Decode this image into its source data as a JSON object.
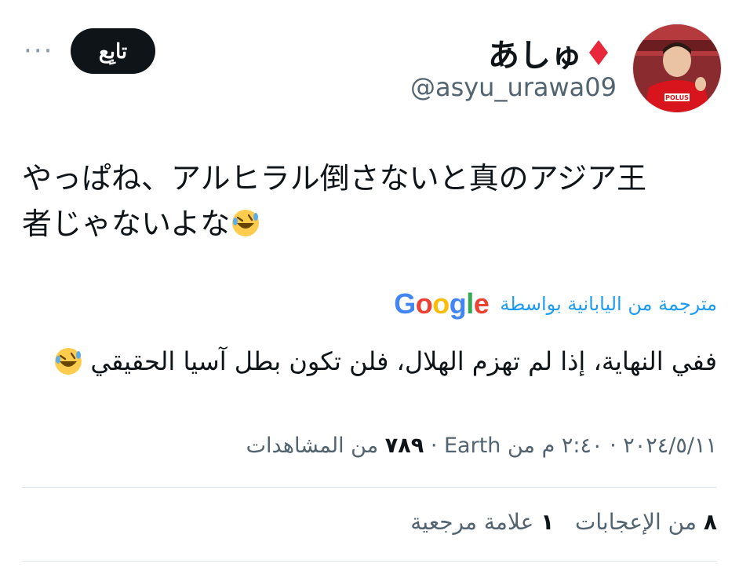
{
  "header": {
    "display_name": "あしゅ",
    "handle": "@asyu_urawa09",
    "follow_label": "تابِع",
    "more_label": "···"
  },
  "tweet": {
    "text_line1": "やっぱね、アルヒラル倒さないと真のアジア王",
    "text_line2": "者じゃないよな",
    "emoji": "rolling-on-floor-laughing"
  },
  "translation": {
    "label": "مترجمة من اليابانية بواسطة",
    "provider": "Google",
    "text": "ففي النهاية، إذا لم تهزم الهلال، فلن تكون بطل آسيا الحقيقي"
  },
  "meta": {
    "date": "٢٠٢٤/٥/١١",
    "time": "٢:٤٠ م",
    "source": "من Earth",
    "views_count": "٧٨٩",
    "views_label": "من المشاهدات"
  },
  "stats": {
    "likes_count": "٨",
    "likes_label": "من الإعجابات",
    "bookmarks_count": "١",
    "bookmarks_label": "علامة مرجعية"
  },
  "colors": {
    "accent": "#1d9bf0",
    "text": "#0f1419",
    "muted": "#536471",
    "divider": "#e1e8ed",
    "club_red": "#d8141c"
  }
}
